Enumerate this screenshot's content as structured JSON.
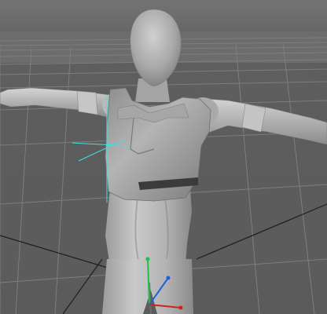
{
  "viewport": {
    "background_top": "#737373",
    "background_floor": "#5b5b5b",
    "grid_color": "#8a8a8a",
    "grid_dark_color": "#1e1e1e",
    "model": {
      "name": "mannequin",
      "skin_color": "#b8b8b8",
      "garment_color": "#9a9a9a",
      "strap_color": "#3b3b3b"
    },
    "gizmo": {
      "x_axis_color": "#d02020",
      "y_axis_color": "#20c040",
      "z_axis_color": "#2060e0",
      "selection_color": "#40e0e8"
    }
  }
}
